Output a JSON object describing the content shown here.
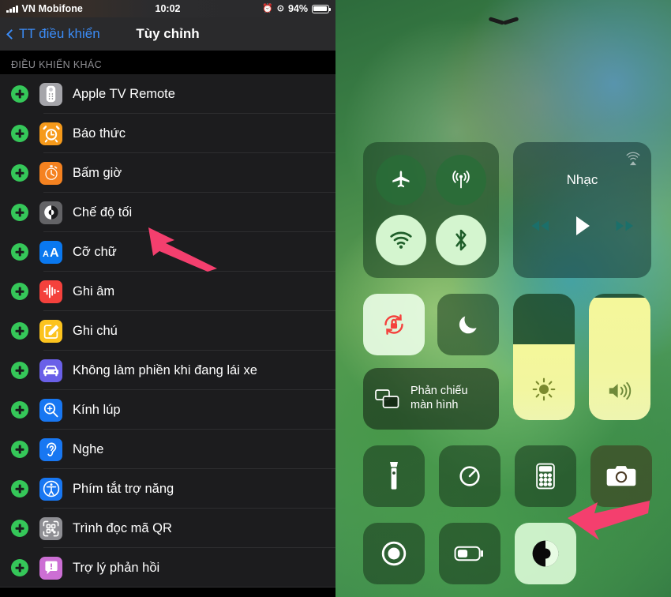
{
  "status_bar": {
    "carrier": "VN Mobifone",
    "signal_icon": "signal-bars-icon",
    "time": "10:02",
    "alarm_icon": "alarm-clock-icon",
    "rotation_lock_icon": "rotation-lock-icon",
    "battery_percent": "94%",
    "battery_level": 94
  },
  "nav": {
    "back_label": "TT điều khiển",
    "back_icon": "chevron-left-icon",
    "title": "Tùy chỉnh"
  },
  "section": {
    "header": "ĐIỀU KHIỂN KHÁC"
  },
  "controls_list": [
    {
      "label": "Apple TV Remote",
      "icon": "apple-tv-remote-icon",
      "color": "#a5a5aa",
      "add_icon": "plus-circle-icon"
    },
    {
      "label": "Báo thức",
      "icon": "alarm-clock-icon",
      "color": "#f69a1b",
      "add_icon": "plus-circle-icon"
    },
    {
      "label": "Bấm giờ",
      "icon": "stopwatch-icon",
      "color": "#f58220",
      "add_icon": "plus-circle-icon"
    },
    {
      "label": "Chế độ tối",
      "icon": "dark-mode-icon",
      "color": "#636366",
      "add_icon": "plus-circle-icon"
    },
    {
      "label": "Cỡ chữ",
      "icon": "text-size-icon",
      "color": "#0a78ef",
      "add_icon": "plus-circle-icon"
    },
    {
      "label": "Ghi âm",
      "icon": "voice-memos-icon",
      "color": "#f4413c",
      "add_icon": "plus-circle-icon"
    },
    {
      "label": "Ghi chú",
      "icon": "notes-icon",
      "color": "#fcc31e",
      "add_icon": "plus-circle-icon"
    },
    {
      "label": "Không làm phiền khi đang lái xe",
      "icon": "car-icon",
      "color": "#6a60e8",
      "add_icon": "plus-circle-icon"
    },
    {
      "label": "Kính lúp",
      "icon": "magnifier-icon",
      "color": "#1877f2",
      "add_icon": "plus-circle-icon"
    },
    {
      "label": "Nghe",
      "icon": "hearing-ear-icon",
      "color": "#1877f2",
      "add_icon": "plus-circle-icon"
    },
    {
      "label": "Phím tắt trợ năng",
      "icon": "accessibility-icon",
      "color": "#1877f2",
      "add_icon": "plus-circle-icon"
    },
    {
      "label": "Trình đọc mã QR",
      "icon": "qr-code-icon",
      "color": "#8e8e93",
      "add_icon": "plus-circle-icon"
    },
    {
      "label": "Trợ lý phản hồi",
      "icon": "feedback-assistant-icon",
      "color": "#cc6fd4",
      "add_icon": "plus-circle-icon"
    }
  ],
  "control_center": {
    "handle_icon": "chevron-down-handle-icon",
    "connectivity": {
      "airplane": {
        "icon": "airplane-icon",
        "state": "off"
      },
      "cellular": {
        "icon": "cellular-data-icon",
        "state": "off"
      },
      "wifi": {
        "icon": "wifi-icon",
        "state": "on"
      },
      "bluetooth": {
        "icon": "bluetooth-icon",
        "state": "on"
      }
    },
    "music": {
      "title": "Nhạc",
      "airplay_icon": "airplay-audio-icon",
      "rewind_icon": "rewind-icon",
      "play_icon": "play-icon",
      "forward_icon": "fast-forward-icon"
    },
    "rotation_lock": {
      "icon": "rotation-lock-icon",
      "state": "on"
    },
    "do_not_disturb": {
      "icon": "moon-icon",
      "state": "off"
    },
    "screen_mirroring": {
      "label_line1": "Phản chiếu",
      "label_line2": "màn hình",
      "icon": "screen-mirroring-icon"
    },
    "brightness": {
      "icon": "brightness-sun-icon",
      "value": 60
    },
    "volume": {
      "icon": "volume-speaker-icon",
      "value": 97
    },
    "tiles": [
      {
        "icon": "flashlight-icon",
        "name": "flashlight",
        "state": "off",
        "style": "dark"
      },
      {
        "icon": "timer-icon",
        "name": "timer",
        "state": "off",
        "style": "dark"
      },
      {
        "icon": "calculator-icon",
        "name": "calculator",
        "state": "off",
        "style": "dark"
      },
      {
        "icon": "camera-icon",
        "name": "camera",
        "state": "off",
        "style": "warm"
      },
      {
        "icon": "screen-record-icon",
        "name": "screen-record",
        "state": "off",
        "style": "dark"
      },
      {
        "icon": "low-power-battery-icon",
        "name": "low-power-mode",
        "state": "off",
        "style": "dark"
      },
      {
        "icon": "dark-mode-icon",
        "name": "dark-mode",
        "state": "on",
        "style": "hi"
      }
    ]
  },
  "annotations": {
    "arrow_color": "#f43f6e",
    "arrow_left_target": "Chế độ tối",
    "arrow_right_target": "dark-mode-tile"
  }
}
